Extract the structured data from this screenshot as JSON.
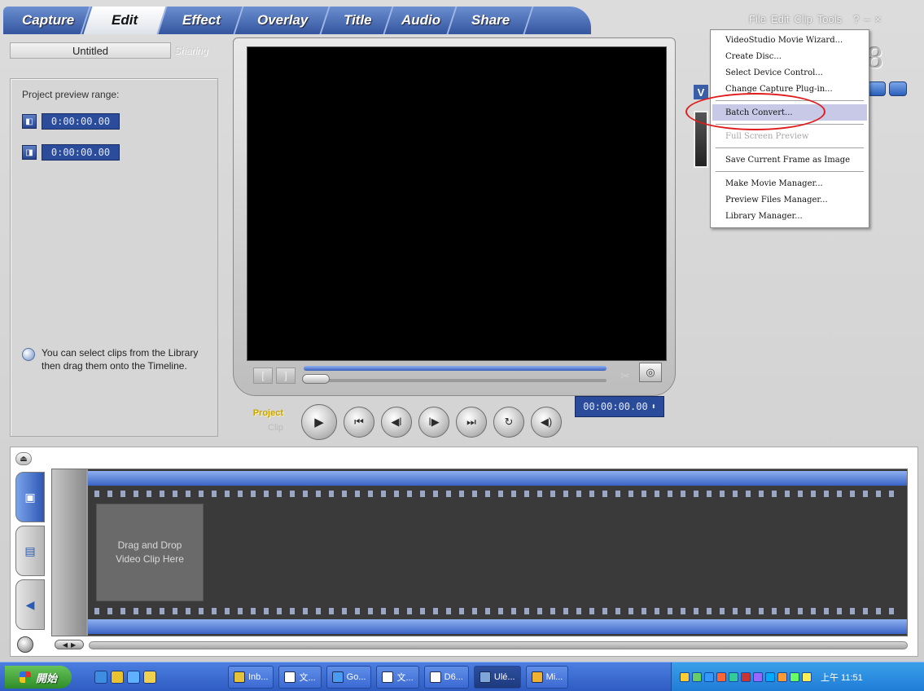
{
  "tabs": [
    {
      "label": "Capture",
      "active": false
    },
    {
      "label": "Edit",
      "active": true
    },
    {
      "label": "Effect",
      "active": false
    },
    {
      "label": "Overlay",
      "active": false
    },
    {
      "label": "Title",
      "active": false
    },
    {
      "label": "Audio",
      "active": false
    },
    {
      "label": "Share",
      "active": false
    }
  ],
  "top_menu": {
    "file": "File",
    "edit": "Edit",
    "clip": "Clip",
    "tools": "Tools",
    "help": "?",
    "minimize": "–",
    "close": "×"
  },
  "logo_version": "8",
  "project_title": "Untitled",
  "faded_button": "Sharing",
  "left_panel": {
    "range_label": "Project preview range:",
    "start_time": "0:00:00.00",
    "end_time": "0:00:00.00",
    "hint": "You can select clips from the Library then drag them onto the Timeline."
  },
  "playback": {
    "mode_project": "Project",
    "mode_clip": "Clip",
    "timecode": "00:00:00.00"
  },
  "context_menu": {
    "items": [
      {
        "label": "VideoStudio Movie Wizard...",
        "state": "normal"
      },
      {
        "label": "Create Disc...",
        "state": "normal"
      },
      {
        "label": "Select Device Control...",
        "state": "normal"
      },
      {
        "label": "Change Capture Plug-in...",
        "state": "normal"
      },
      {
        "label": "Batch Convert...",
        "state": "highlight"
      },
      {
        "label": "Full Screen Preview",
        "state": "disabled"
      },
      {
        "label": "Save Current Frame as Image",
        "state": "normal"
      },
      {
        "label": "Make Movie Manager...",
        "state": "normal"
      },
      {
        "label": "Preview Files Manager...",
        "state": "normal"
      },
      {
        "label": "Library Manager...",
        "state": "normal"
      }
    ]
  },
  "timeline": {
    "drop_hint": "Drag and Drop Video Clip Here"
  },
  "taskbar": {
    "start_label": "開始",
    "tasks": [
      {
        "label": "Inb...",
        "active": false
      },
      {
        "label": "文...",
        "active": false
      },
      {
        "label": "Go...",
        "active": false
      },
      {
        "label": "文...",
        "active": false
      },
      {
        "label": "D6...",
        "active": false
      },
      {
        "label": "Ulé...",
        "active": true
      },
      {
        "label": "Mi...",
        "active": false
      }
    ],
    "clock": "上午 11:51"
  },
  "colors": {
    "tab_blue": "#3a5ca8",
    "highlight": "#c7c9e6",
    "annotation_red": "#e01b1b",
    "film_blue": "#3a64c4",
    "project_gold": "#c8a400"
  }
}
